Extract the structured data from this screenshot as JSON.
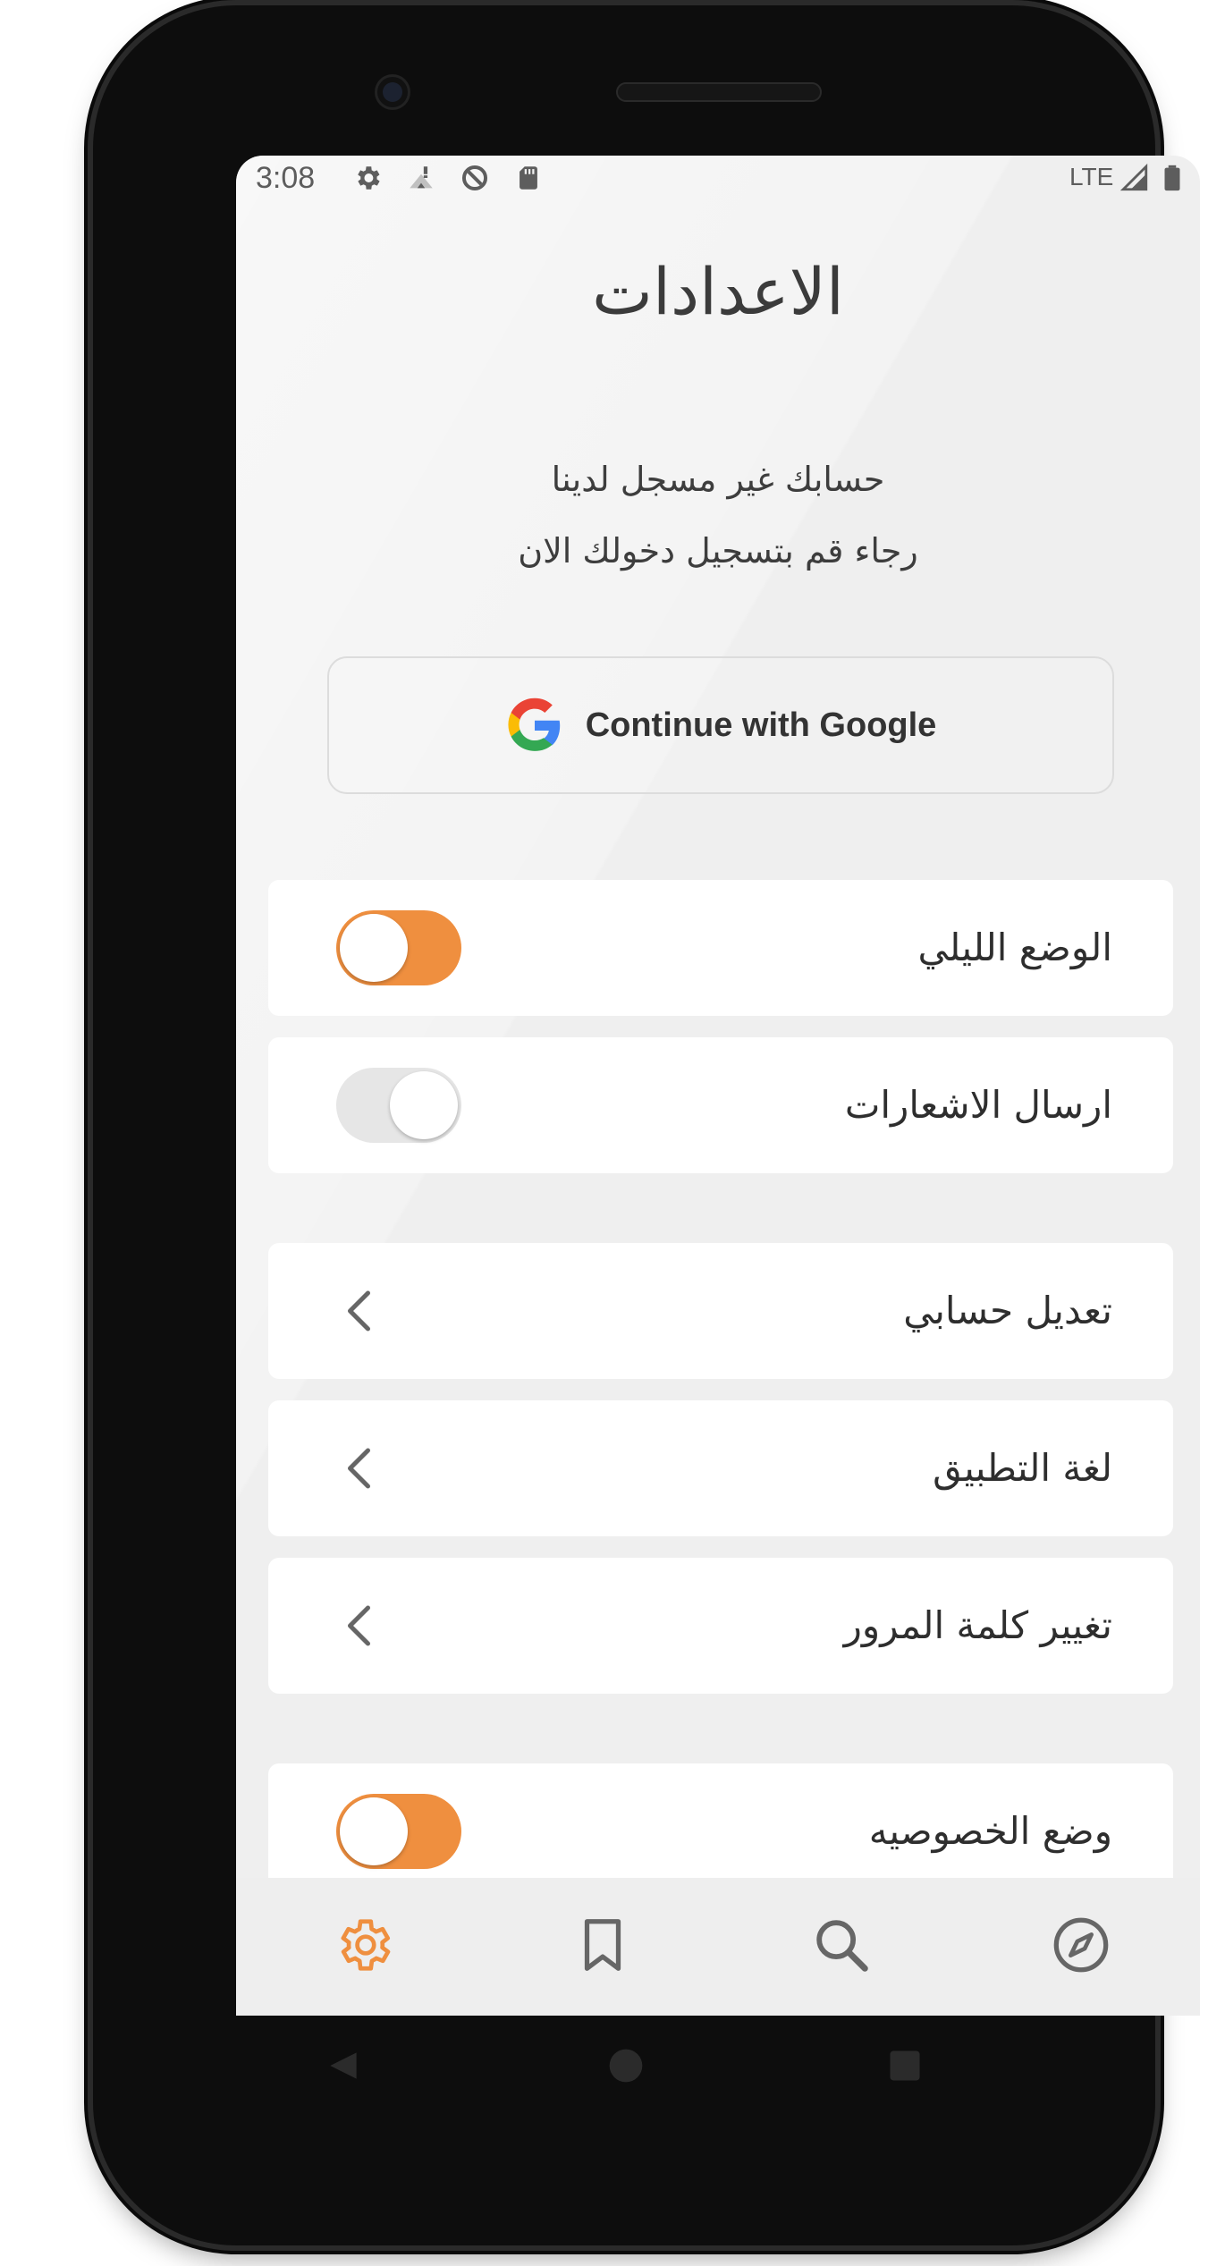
{
  "status_bar": {
    "time": "3:08",
    "network": "LTE",
    "icons": [
      "gear-icon",
      "wifi-icon",
      "data-saver-icon",
      "sd-card-icon",
      "signal-icon",
      "battery-icon"
    ]
  },
  "page": {
    "title": "الاعدادات",
    "message_line1": "حسابك غير مسجل لدينا",
    "message_line2": "رجاء قم بتسجيل دخولك الان"
  },
  "google_button": {
    "label": "Continue with Google",
    "icon": "google-g-icon"
  },
  "settings": {
    "night_mode": {
      "label": "الوضع الليلي",
      "enabled": true
    },
    "notifications": {
      "label": "ارسال الاشعارات",
      "enabled": false
    },
    "edit_account": {
      "label": "تعديل حسابي",
      "icon": "chevron-left-icon"
    },
    "app_language": {
      "label": "لغة التطبيق",
      "icon": "chevron-left-icon"
    },
    "change_password": {
      "label": "تغيير كلمة المرور",
      "icon": "chevron-left-icon"
    },
    "privacy_mode": {
      "label": "وضع الخصوصيه",
      "enabled": true
    }
  },
  "bottom_nav": {
    "items": [
      {
        "icon": "gear-icon",
        "active": true
      },
      {
        "icon": "bookmark-icon",
        "active": false
      },
      {
        "icon": "search-icon",
        "active": false
      },
      {
        "icon": "compass-icon",
        "active": false
      }
    ]
  },
  "colors": {
    "accent": "#ef8f3f",
    "background": "#efefef",
    "card": "#ffffff",
    "text": "#2e2e2e"
  }
}
